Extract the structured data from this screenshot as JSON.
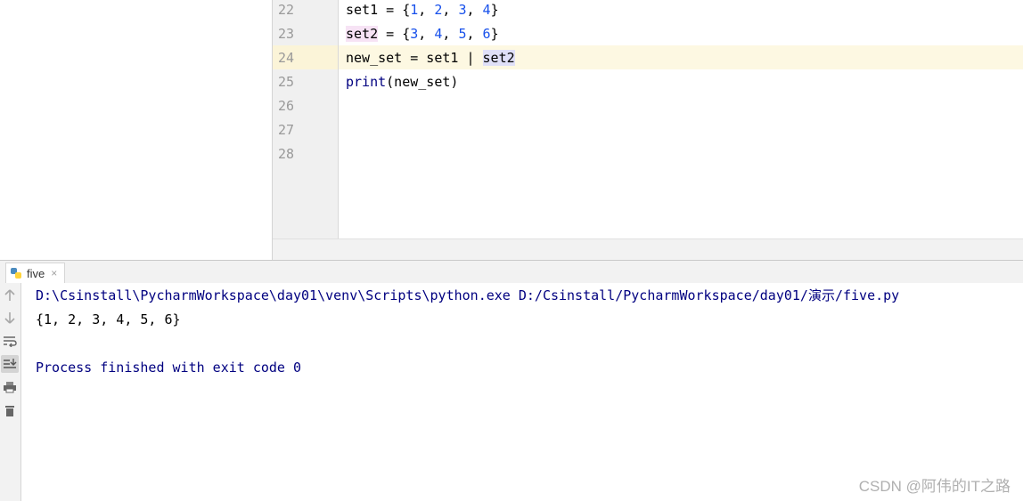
{
  "editor": {
    "line_numbers": [
      "22",
      "23",
      "24",
      "25",
      "26",
      "27",
      "28"
    ],
    "lines": {
      "l22": {
        "var": "set1",
        "eq": " = {",
        "n1": "1",
        "c1": ", ",
        "n2": "2",
        "c2": ", ",
        "n3": "3",
        "c3": ", ",
        "n4": "4",
        "end": "}"
      },
      "l23": {
        "var": "set2",
        "eq": " = {",
        "n1": "3",
        "c1": ", ",
        "n2": "4",
        "c2": ", ",
        "n3": "5",
        "c3": ", ",
        "n4": "6",
        "end": "}"
      },
      "l24": {
        "lhs": "new_set = set1 | ",
        "var": "set2"
      },
      "l25": {
        "fn": "print",
        "args": "(new_set)"
      }
    }
  },
  "run": {
    "tab_label": "five",
    "tab_close": "×",
    "console": {
      "command": "D:\\Csinstall\\PycharmWorkspace\\day01\\venv\\Scripts\\python.exe D:/Csinstall/PycharmWorkspace/day01/演示/five.py",
      "output": "{1, 2, 3, 4, 5, 6}",
      "exit": "Process finished with exit code 0"
    },
    "toolbar_icons": [
      "arrow-up-icon",
      "arrow-down-icon",
      "soft-wrap-icon",
      "scroll-to-end-icon",
      "print-icon",
      "trash-icon"
    ]
  },
  "watermark": "CSDN @阿伟的IT之路",
  "colors": {
    "keyword": "#000080",
    "number": "#1750eb",
    "caret_line": "#fdf8e2"
  }
}
